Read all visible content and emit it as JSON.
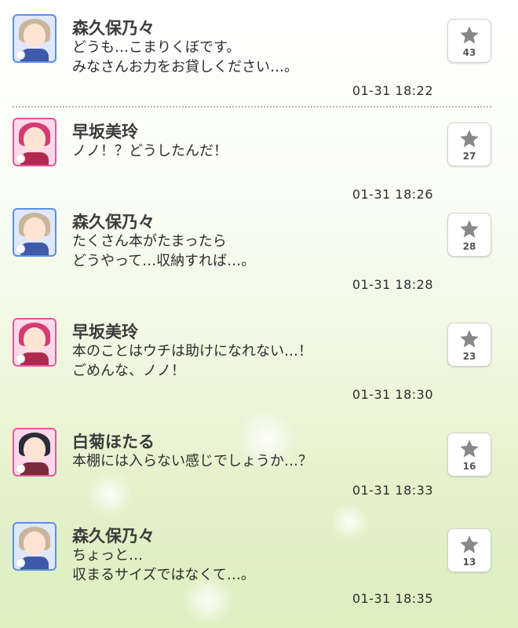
{
  "posts": [
    {
      "name": "森久保乃々",
      "lines": [
        "どうも…こまりくぼです。",
        "みなさんお力をお貸しください…。"
      ],
      "time": "01-31 18:22",
      "likes": "43",
      "avatar": "morikubo"
    },
    {
      "name": "早坂美玲",
      "lines": [
        "ノノ！？どうしたんだ！"
      ],
      "time": "01-31 18:26",
      "likes": "27",
      "avatar": "hayasaka"
    },
    {
      "name": "森久保乃々",
      "lines": [
        "たくさん本がたまったら",
        "どうやって…収納すれば…。"
      ],
      "time": "01-31 18:28",
      "likes": "28",
      "avatar": "morikubo"
    },
    {
      "name": "早坂美玲",
      "lines": [
        "本のことはウチは助けになれない…！",
        "ごめんな、ノノ！"
      ],
      "time": "01-31 18:30",
      "likes": "23",
      "avatar": "hayasaka"
    },
    {
      "name": "白菊ほたる",
      "lines": [
        "本棚には入らない感じでしょうか…？"
      ],
      "time": "01-31 18:33",
      "likes": "16",
      "avatar": "shiragiku"
    },
    {
      "name": "森久保乃々",
      "lines": [
        "ちょっと…",
        "収まるサイズではなくて…。"
      ],
      "time": "01-31 18:35",
      "likes": "13",
      "avatar": "morikubo"
    }
  ],
  "icons": {
    "like": "star-icon",
    "avatar_badge": "attribute-badge-icon"
  },
  "colors": {
    "cool_frame": "#5b8fe6",
    "cute_frame": "#e5579a",
    "star": "#888888",
    "text": "#2d2d2d"
  }
}
